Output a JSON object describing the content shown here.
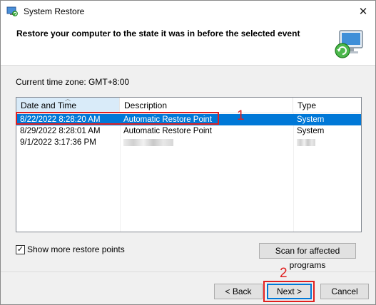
{
  "window": {
    "title": "System Restore",
    "close_glyph": "✕"
  },
  "header": {
    "heading": "Restore your computer to the state it was in before the selected event",
    "icon": "system-restore-icon"
  },
  "timezone_label": "Current time zone: GMT+8:00",
  "table": {
    "columns": [
      "Date and Time",
      "Description",
      "Type"
    ],
    "sorted_column": "Date and Time",
    "rows": [
      {
        "date": "8/22/2022 8:28:20 AM",
        "description": "Automatic Restore Point",
        "type": "System",
        "selected": true
      },
      {
        "date": "8/29/2022 8:28:01 AM",
        "description": "Automatic Restore Point",
        "type": "System",
        "selected": false
      },
      {
        "date": "9/1/2022 3:17:36 PM",
        "description": "",
        "type": "",
        "selected": false
      }
    ]
  },
  "annotations": {
    "callout_1": "1",
    "callout_2": "2",
    "color": "#e02020"
  },
  "checkbox": {
    "label": "Show more restore points",
    "checked": true,
    "check_glyph": "✓"
  },
  "buttons": {
    "scan": "Scan for affected programs",
    "back": "< Back",
    "next": "Next >",
    "cancel": "Cancel"
  },
  "colors": {
    "selection": "#0078d7",
    "sorted_header": "#d9ebf9"
  }
}
